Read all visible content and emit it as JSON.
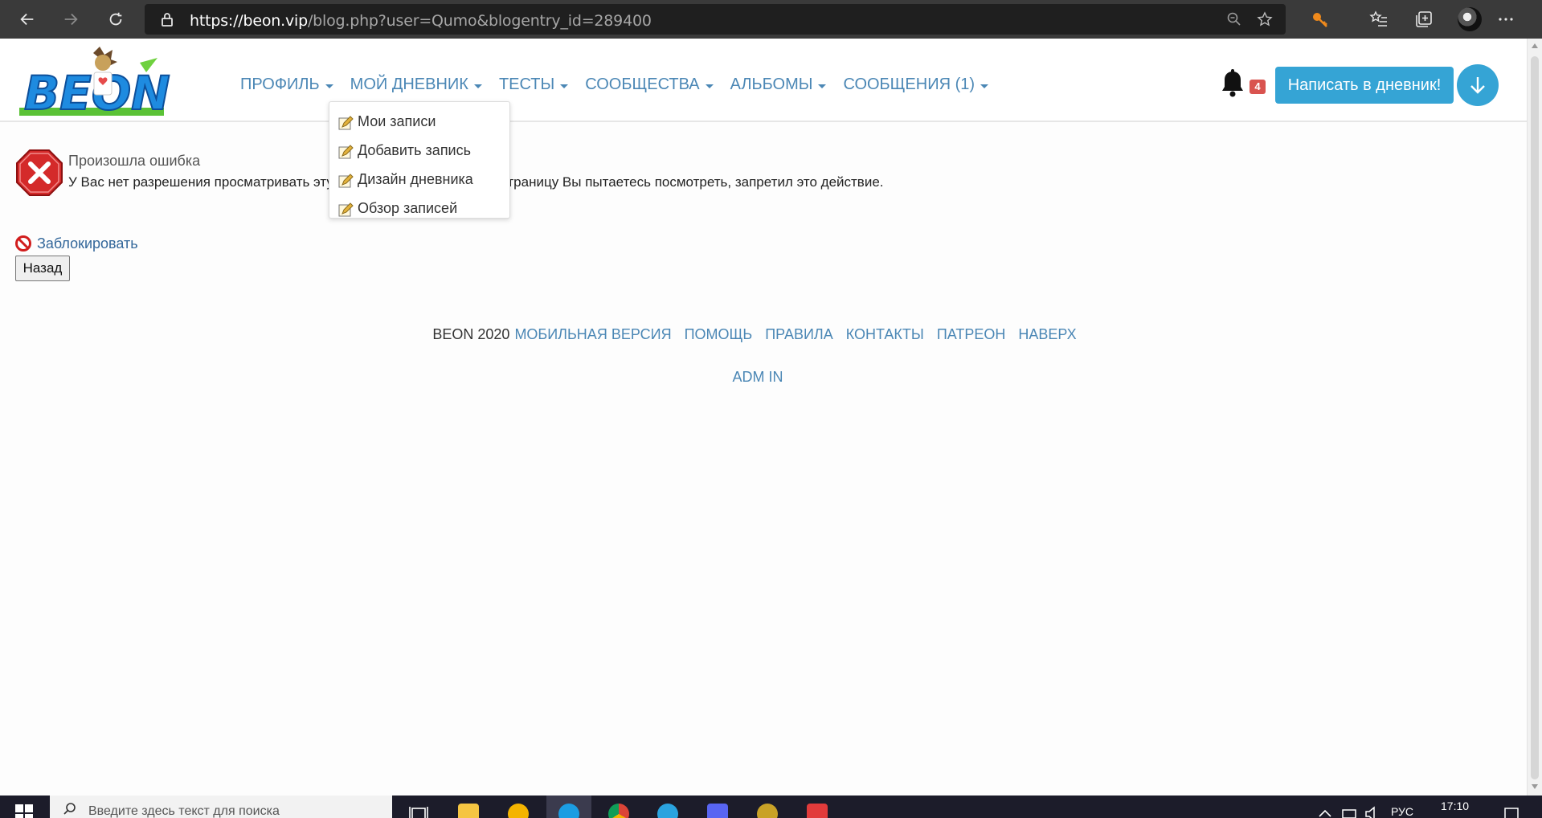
{
  "browser": {
    "url_scheme": "https://",
    "url_host": "beon.vip",
    "url_path": "/blog.php?user=Qumo&blogentry_id=289400"
  },
  "header": {
    "logo_text": "BEON",
    "nav": [
      {
        "label": "ПРОФИЛЬ"
      },
      {
        "label": "МОЙ ДНЕВНИК"
      },
      {
        "label": "ТЕСТЫ"
      },
      {
        "label": "СООБЩЕСТВА"
      },
      {
        "label": "АЛЬБОМЫ"
      },
      {
        "label": "СООБЩЕНИЯ (1)"
      }
    ],
    "notifications_count": "4",
    "write_button": "Написать в дневник!"
  },
  "dropdown": {
    "items": [
      {
        "label": "Мои записи"
      },
      {
        "label": "Добавить запись"
      },
      {
        "label": "Дизайн дневника"
      },
      {
        "label": "Обзор записей"
      }
    ]
  },
  "error": {
    "title": "Произошла ошибка",
    "message": "У Вас нет разрешения просматривать эту страницу. Владелец, чью страницу Вы пытаетесь посмотреть, запретил это действие."
  },
  "actions": {
    "block_label": "Заблокировать",
    "back_label": "Назад"
  },
  "footer": {
    "copyright": "BEON 2020",
    "links": [
      {
        "label": "МОБИЛЬНАЯ ВЕРСИЯ"
      },
      {
        "label": "ПОМОЩЬ"
      },
      {
        "label": "ПРАВИЛА"
      },
      {
        "label": "КОНТАКТЫ"
      },
      {
        "label": "ПАТРЕОН"
      },
      {
        "label": "НАВЕРХ"
      }
    ],
    "admin_label": "ADM IN"
  },
  "taskbar": {
    "search_placeholder": "Введите здесь текст для поиска",
    "language": "РУС",
    "time": "17:10"
  },
  "colors": {
    "link": "#4b87b5",
    "accent_button": "#35a4d5",
    "badge": "#d9534f",
    "browser_chrome": "#3a3a3a"
  }
}
